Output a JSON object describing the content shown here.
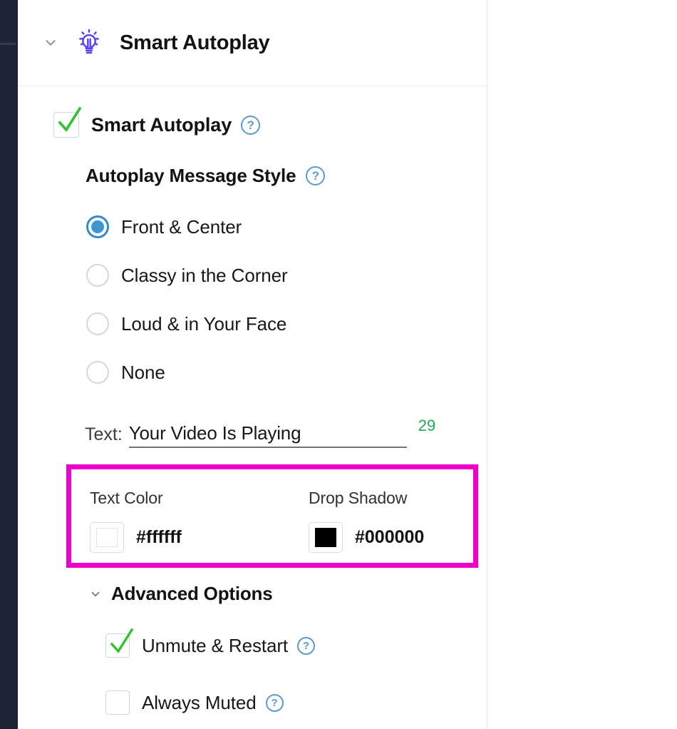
{
  "rail": {
    "name": "app-side-rail"
  },
  "header": {
    "title": "Smart Autoplay",
    "collapse_icon": "chevron-down-icon",
    "feature_icon": "lightbulb-icon"
  },
  "master_toggle": {
    "label": "Smart Autoplay",
    "checked": true,
    "help_icon": "question-mark-icon",
    "help_label": "?"
  },
  "message_style": {
    "heading": "Autoplay Message Style",
    "help_label": "?",
    "options": [
      {
        "label": "Front & Center",
        "selected": true
      },
      {
        "label": "Classy in the Corner",
        "selected": false
      },
      {
        "label": "Loud & in Your Face",
        "selected": false
      },
      {
        "label": "None",
        "selected": false
      }
    ]
  },
  "text_field": {
    "caption": "Text:",
    "value": "Your Video Is Playing",
    "char_count": "29",
    "char_count_color": "#1faa55"
  },
  "color_section": {
    "highlight_color": "#ee00cc",
    "columns": [
      {
        "label": "Text Color",
        "hex": "#ffffff",
        "swatch_color": "#ffffff"
      },
      {
        "label": "Drop Shadow",
        "hex": "#000000",
        "swatch_color": "#000000"
      }
    ]
  },
  "advanced": {
    "heading": "Advanced Options",
    "chevron_icon": "chevron-down-icon",
    "items": [
      {
        "label": "Unmute & Restart",
        "checked": true,
        "help_label": "?"
      },
      {
        "label": "Always Muted",
        "checked": false,
        "help_label": "?"
      }
    ]
  }
}
